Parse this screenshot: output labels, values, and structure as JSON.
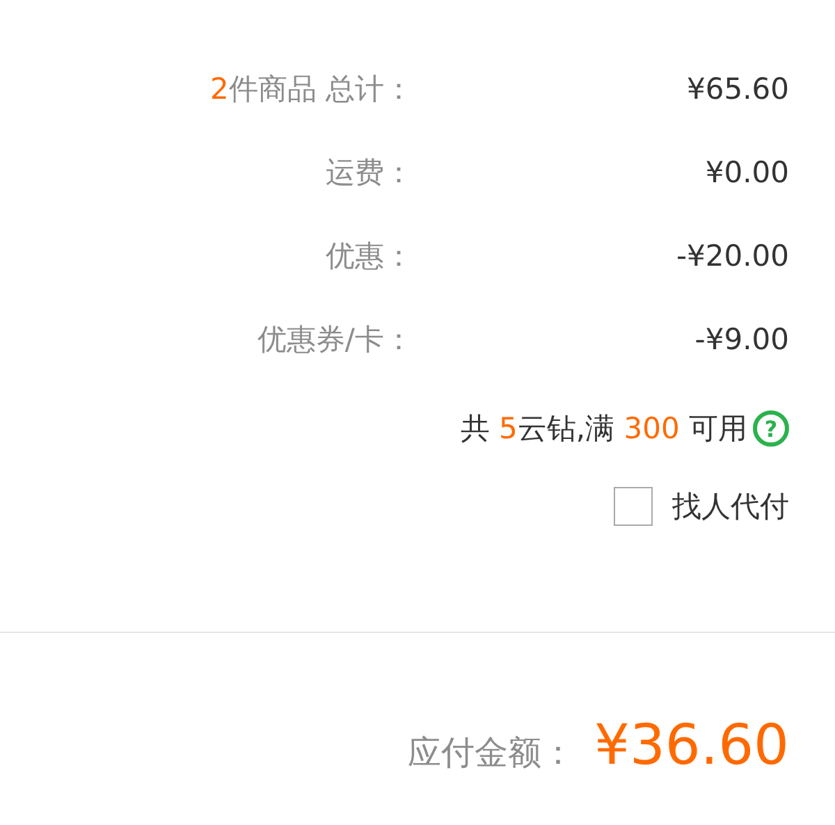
{
  "summary": [
    {
      "label_prefix": "2",
      "label": "件商品 总计：",
      "value": "¥65.60"
    },
    {
      "label": "运费：",
      "value": "¥0.00"
    },
    {
      "label": "优惠：",
      "value": "-¥20.00"
    },
    {
      "label": "优惠券/卡：",
      "value": "-¥9.00"
    }
  ],
  "diamonds": {
    "parts": [
      {
        "text": "共 ",
        "highlight": false
      },
      {
        "text": "5",
        "highlight": true
      },
      {
        "text": "云钻,满 ",
        "highlight": false
      },
      {
        "text": "300",
        "highlight": true
      },
      {
        "text": " 可用",
        "highlight": false
      }
    ],
    "help": "?"
  },
  "pay_for_me": {
    "label": "找人代付",
    "checked": false
  },
  "total": {
    "label": "应付金额：",
    "value": "¥36.60"
  }
}
